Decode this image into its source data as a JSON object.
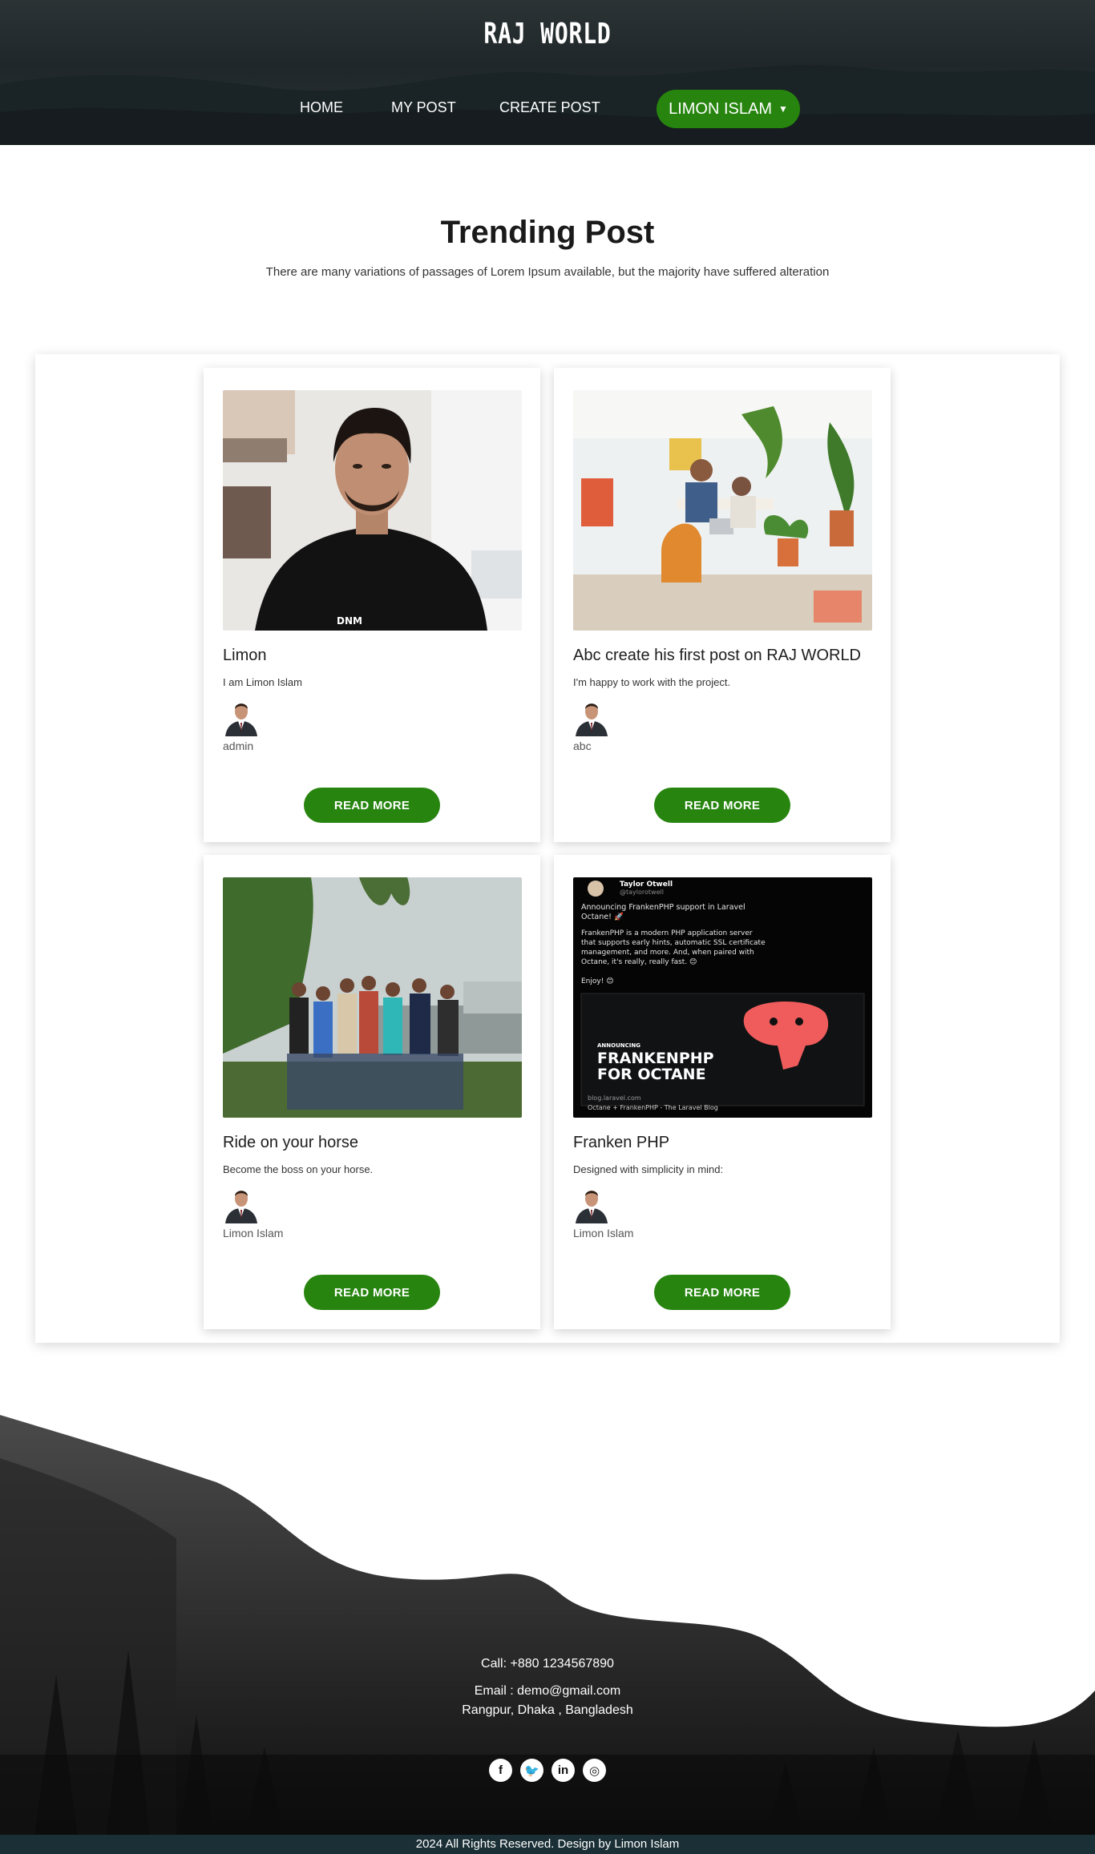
{
  "header": {
    "brand": "RAJ WORLD",
    "nav": [
      "HOME",
      "MY POST",
      "CREATE POST"
    ],
    "user_menu_label": "LIMON ISLAM",
    "user_menu_icon": "chevron-down-icon"
  },
  "trending": {
    "title": "Trending Post",
    "subtitle": "There are many variations of passages of Lorem Ipsum available, but the majority have suffered alteration"
  },
  "posts": [
    {
      "title": "Limon",
      "excerpt": "I am Limon Islam",
      "author": "admin",
      "button": "READ MORE"
    },
    {
      "title": "Abc create his first post on RAJ WORLD",
      "excerpt": "I'm happy to work with the project.",
      "author": "abc",
      "button": "READ MORE"
    },
    {
      "title": "Ride on your horse",
      "excerpt": "Become the boss on your horse.",
      "author": "Limon Islam",
      "button": "READ MORE"
    },
    {
      "title": "Franken PHP",
      "excerpt": "Designed with simplicity in mind:",
      "author": "Limon Islam",
      "button": "READ MORE"
    }
  ],
  "tweet_image": {
    "name": "Taylor Otwell",
    "handle": "@taylorotwell",
    "line1": "Announcing FrankenPHP support in Laravel",
    "line2": "Octane! 🚀",
    "body1": "FrankenPHP is a modern PHP application server",
    "body2": "that supports early hints, automatic SSL certificate",
    "body3": "management, and more. And, when paired with",
    "body4": "Octane, it's really, really fast. 😊",
    "enjoy": "Enjoy! 😊",
    "announcing": "ANNOUNCING",
    "headline1": "FRANKENPHP",
    "headline2": "FOR OCTANE",
    "link": "blog.laravel.com",
    "link_title": "Octane + FrankenPHP - The Laravel Blog"
  },
  "footer": {
    "call": "Call: +880 1234567890",
    "email": "Email : demo@gmail.com",
    "address": "Rangpur, Dhaka , Bangladesh",
    "socials": [
      "facebook-icon",
      "twitter-icon",
      "linkedin-icon",
      "instagram-icon"
    ],
    "social_glyphs": [
      "f",
      "🐦",
      "in",
      "◎"
    ],
    "copyright": "2024 All Rights Reserved. Design by Limon Islam"
  },
  "colors": {
    "accent": "#27850f",
    "header_bg": "#232c2f",
    "footer_bar": "#1a3036"
  }
}
